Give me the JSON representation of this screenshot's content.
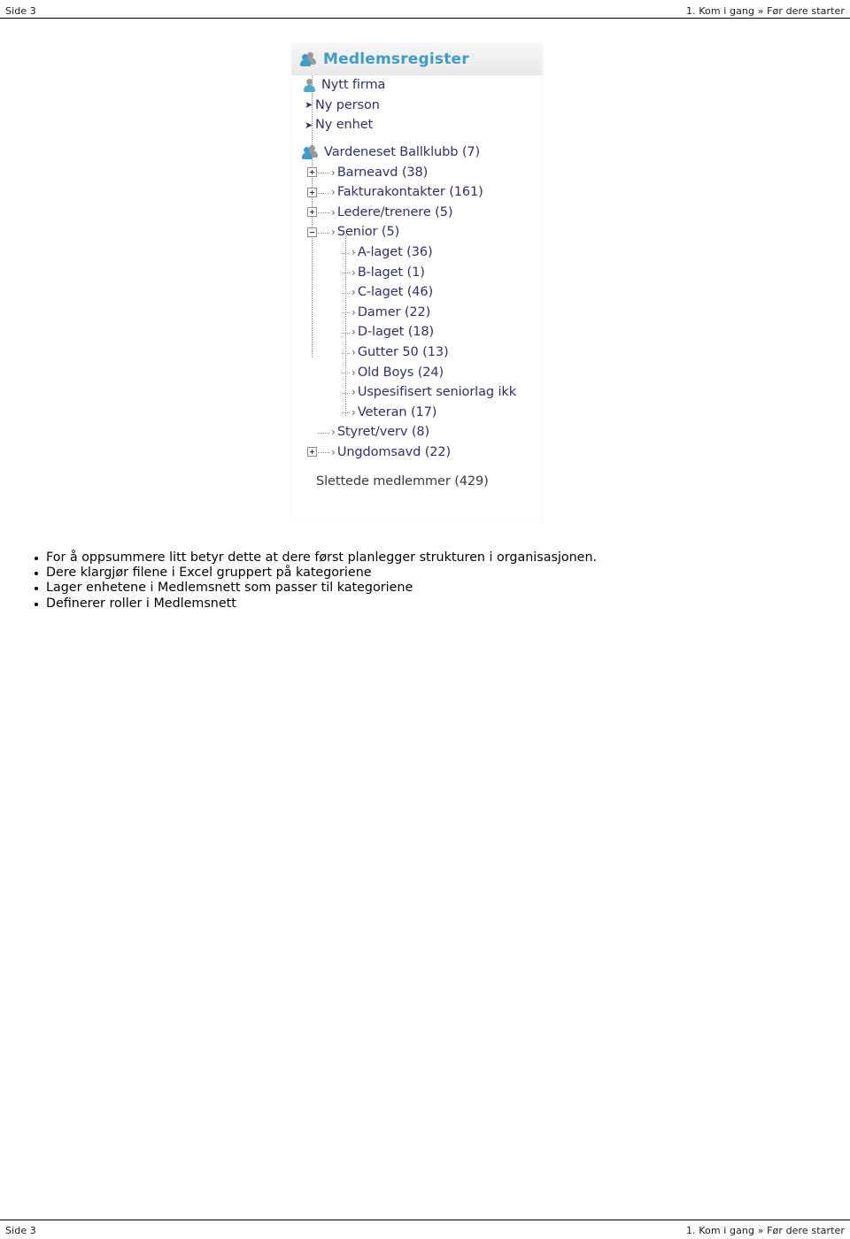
{
  "header": {
    "left": "Side 3",
    "right": "1. Kom i gang » Før dere starter"
  },
  "footer": {
    "left": "Side 3",
    "right": "1. Kom i gang » Før dere starter"
  },
  "register_panel": {
    "title": "Medlemsregister",
    "title_icon": "people-icon",
    "title_color": "#3f9cc4",
    "actions": [
      {
        "label": "Nytt firma",
        "icon": "person-icon"
      },
      {
        "label": "Ny person",
        "icon": "arrow-right-icon"
      },
      {
        "label": "Ny enhet",
        "icon": "arrow-right-icon"
      }
    ],
    "tree": {
      "root": {
        "label": "Vardeneset Ballklubb (7)",
        "icon": "people-icon"
      },
      "groups": [
        {
          "label": "Barneavd (38)",
          "state": "collapsed"
        },
        {
          "label": "Fakturakontakter (161)",
          "state": "collapsed"
        },
        {
          "label": "Ledere/trenere (5)",
          "state": "collapsed"
        },
        {
          "label": "Senior (5)",
          "state": "expanded"
        }
      ],
      "senior_children": [
        {
          "label": "A-laget (36)"
        },
        {
          "label": "B-laget (1)"
        },
        {
          "label": "C-laget (46)"
        },
        {
          "label": "Damer (22)"
        },
        {
          "label": "D-laget (18)"
        },
        {
          "label": "Gutter 50 (13)"
        },
        {
          "label": "Old Boys (24)"
        },
        {
          "label": "Uspesifisert seniorlag ikk"
        },
        {
          "label": "Veteran (17)"
        }
      ],
      "groups_after": [
        {
          "label": "Styret/verv (8)",
          "state": "leaf"
        },
        {
          "label": "Ungdomsavd (22)",
          "state": "collapsed"
        }
      ],
      "deleted": {
        "label": "Slettede medlemmer (429)"
      }
    }
  },
  "bullets": [
    "For å oppsummere litt betyr dette at dere først planlegger strukturen i organisasjonen.",
    "Dere klargjør filene i Excel gruppert på kategoriene",
    "Lager enhetene i Medlemsnett som passer til kategoriene",
    "Definerer roller i Medlemsnett"
  ]
}
